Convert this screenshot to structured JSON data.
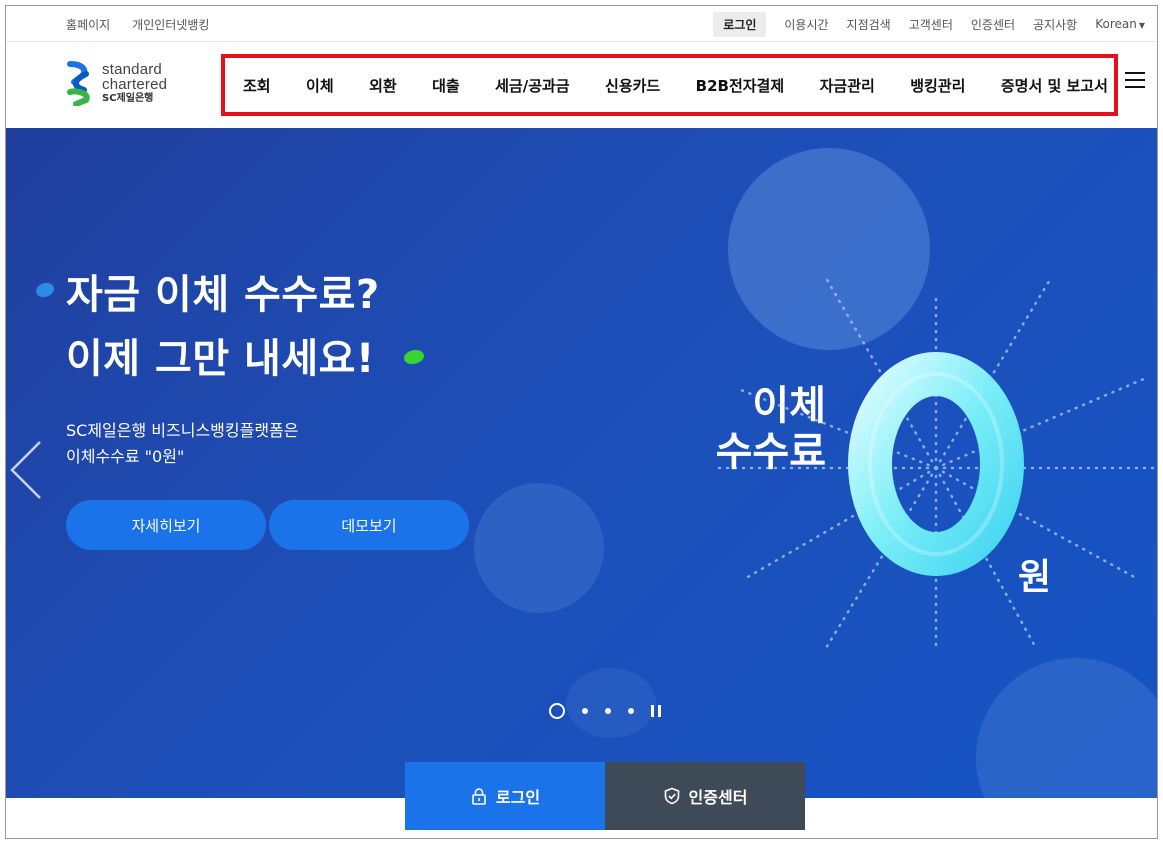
{
  "util": {
    "left_links": [
      "홈페이지",
      "개인인터넷뱅킹"
    ],
    "login": "로그인",
    "right_links": [
      "이용시간",
      "지점검색",
      "고객센터",
      "인증센터",
      "공지사항"
    ],
    "language": "Korean"
  },
  "logo": {
    "line1": "standard",
    "line2": "chartered",
    "line3": "SC제일은행"
  },
  "gnb": {
    "items": [
      "조회",
      "이체",
      "외환",
      "대출",
      "세금/공과금",
      "신용카드",
      "B2B전자결제",
      "자금관리",
      "뱅킹관리",
      "증명서 및 보고서"
    ],
    "highlight_color": "#e5101c"
  },
  "hero": {
    "headline_line1": "자금 이체 수수료?",
    "headline_line2": "이제 그만 내세요!",
    "sub_line1": "SC제일은행 비즈니스뱅킹플랫폼은",
    "sub_line2": "이체수수료 \"0원\"",
    "button_detail": "자세히보기",
    "button_demo": "데모보기",
    "graphic_label_line1": "이체",
    "graphic_label_line2": "수수료",
    "graphic_zero": "0",
    "graphic_unit": "원",
    "background_color": "#1e4fb8"
  },
  "quick": {
    "login": "로그인",
    "cert": "인증센터"
  }
}
